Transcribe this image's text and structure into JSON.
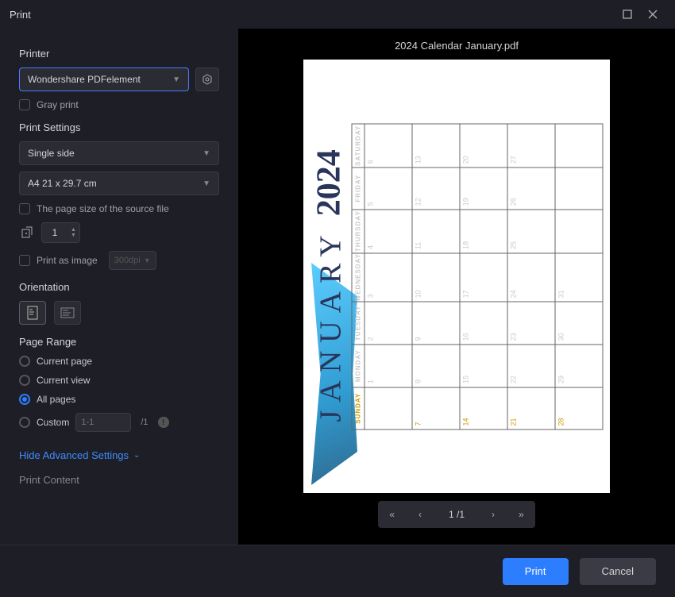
{
  "window": {
    "title": "Print"
  },
  "printerSection": {
    "label": "Printer",
    "selected": "Wondershare PDFelement",
    "grayPrint": "Gray print"
  },
  "printSettings": {
    "label": "Print Settings",
    "duplex": "Single side",
    "paper": "A4 21 x 29.7 cm",
    "sourceSize": "The page size of the source file",
    "copies": "1",
    "printAsImage": "Print as image",
    "dpi": "300dpi"
  },
  "orientation": {
    "label": "Orientation"
  },
  "pageRange": {
    "label": "Page Range",
    "current": "Current page",
    "view": "Current view",
    "all": "All pages",
    "custom": "Custom",
    "customPlaceholder": "1-1",
    "slash": "/1"
  },
  "advanced": {
    "toggle": "Hide Advanced Settings",
    "next": "Print Content"
  },
  "preview": {
    "filename": "2024 Calendar January.pdf",
    "month": "JANUARY",
    "year": "2024",
    "days": [
      "SUNDAY",
      "MONDAY",
      "TUESDAY",
      "WEDNESDAY",
      "THURSDAY",
      "FRIDAY",
      "SATURDAY"
    ],
    "weeks": [
      [
        "",
        "1",
        "2",
        "3",
        "4",
        "5",
        "6"
      ],
      [
        "7",
        "8",
        "9",
        "10",
        "11",
        "12",
        "13"
      ],
      [
        "14",
        "15",
        "16",
        "17",
        "18",
        "19",
        "20"
      ],
      [
        "21",
        "22",
        "23",
        "24",
        "25",
        "26",
        "27"
      ],
      [
        "28",
        "29",
        "30",
        "31",
        "",
        "",
        ""
      ]
    ],
    "page": "1",
    "total": "1"
  },
  "footer": {
    "print": "Print",
    "cancel": "Cancel"
  }
}
